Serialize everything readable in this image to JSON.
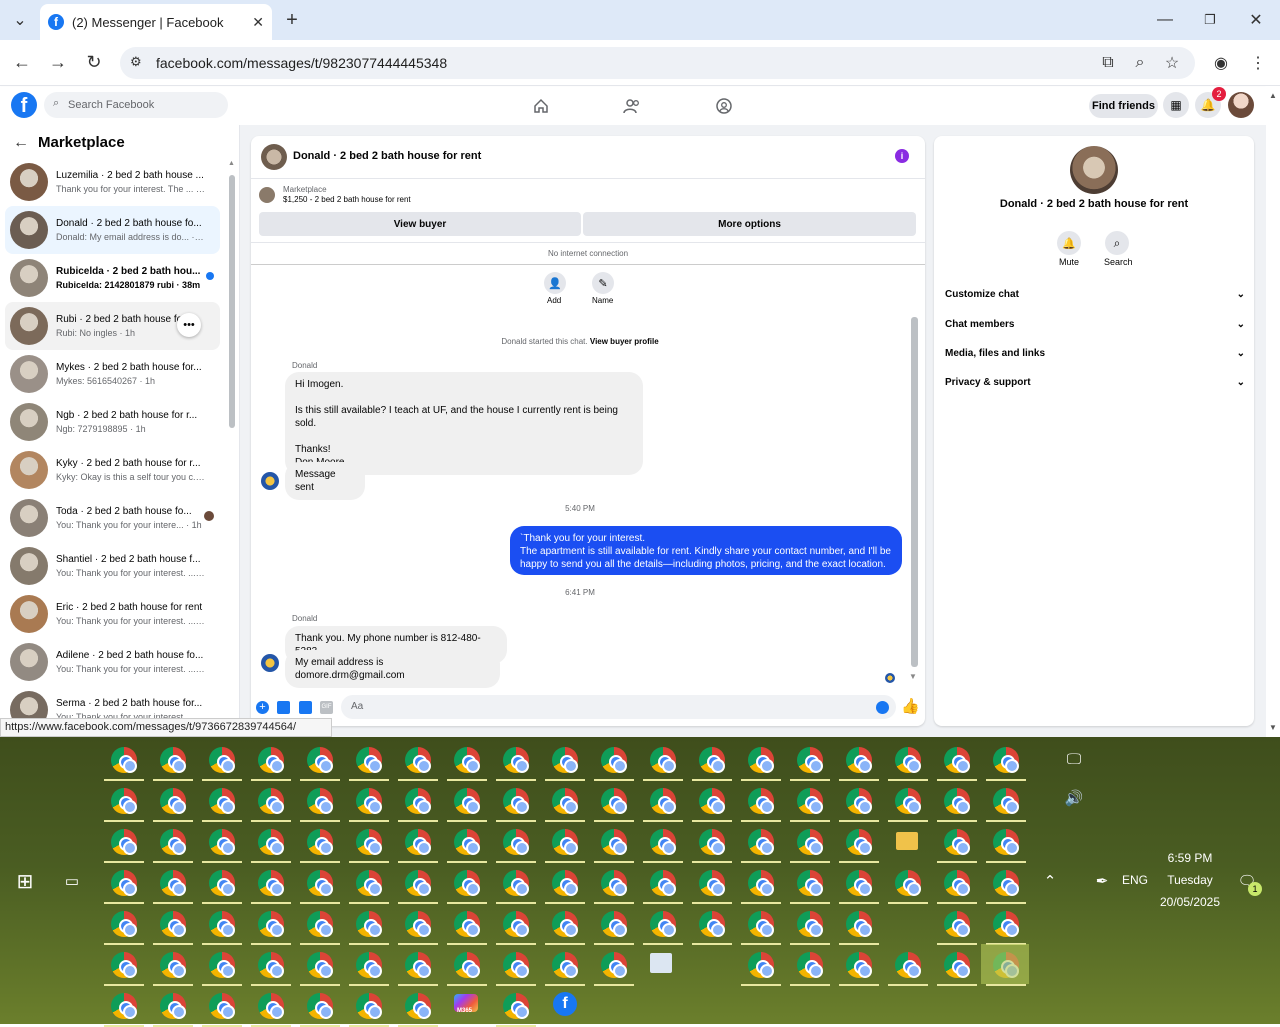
{
  "browser": {
    "tab_title": "(2) Messenger | Facebook",
    "url": "facebook.com/messages/t/9823077444445348",
    "status_url": "https://www.facebook.com/messages/t/9736672839744564/"
  },
  "fb": {
    "search_placeholder": "Search Facebook",
    "find_friends": "Find friends",
    "notif_count": "2"
  },
  "sidebar": {
    "title": "Marketplace",
    "conversations": [
      {
        "name": "Luzemilia · 2 bed 2 bath house ...",
        "preview": "Thank you for your interest. The ... · 1m"
      },
      {
        "name": "Donald · 2 bed 2 bath house fo...",
        "preview": "Donald: My email address is do... · 17m"
      },
      {
        "name": "Rubicelda · 2 bed 2 bath hou...",
        "preview": "Rubicelda: 2142801879 rubi · 38m"
      },
      {
        "name": "Rubi · 2 bed 2 bath house fo...",
        "preview": "Rubi: No ingles · 1h"
      },
      {
        "name": "Mykes · 2 bed 2 bath house for...",
        "preview": "Mykes: 5616540267 · 1h"
      },
      {
        "name": "Ngb · 2 bed 2 bath house for r...",
        "preview": "Ngb: 7279198895 · 1h"
      },
      {
        "name": "Kyky · 2 bed 2 bath house for r...",
        "preview": "Kyky: Okay is this a self tour you c... · 1h"
      },
      {
        "name": "Toda · 2 bed 2 bath house fo...",
        "preview": "You: Thank you for your intere... · 1h"
      },
      {
        "name": "Shantiel · 2 bed 2 bath house f...",
        "preview": "You: Thank you for your interest. ... · 1h"
      },
      {
        "name": "Eric · 2 bed 2 bath house for rent",
        "preview": "You: Thank you for your interest. ... · 1h"
      },
      {
        "name": "Adilene · 2 bed 2 bath house fo...",
        "preview": "You: Thank you for your interest. ... · 1h"
      },
      {
        "name": "Serma · 2 bed 2 bath house for...",
        "preview": "You: Thank you for your interest. ... · 1h"
      }
    ]
  },
  "chat": {
    "title": "Donald · 2 bed 2 bath house for rent",
    "listing_source": "Marketplace",
    "listing": "$1,250 - 2 bed 2 bath house for rent",
    "view_buyer": "View buyer",
    "more_options": "More options",
    "connection": "No internet connection",
    "add_label": "Add",
    "name_label": "Name",
    "started_text": "Donald started this chat.",
    "view_profile": "View buyer profile",
    "sender_name": "Donald",
    "msg1": "Hi Imogen.\n\nIs this still available? I teach at UF, and the house I currently rent is being sold.\n\nThanks!\nDon Moore",
    "msg2": "Message sent",
    "time1": "5:40 PM",
    "msg3": "`Thank you for your interest.\nThe apartment is still available for rent. Kindly share your contact number, and I'll be happy to send you all the details—including photos, pricing, and the exact location.",
    "time2": "6:41 PM",
    "msg4": "Thank you. My phone number is 812-480-5283",
    "msg5": "My email address is domore.drm@gmail.com",
    "input_placeholder": "Aa"
  },
  "info": {
    "title": "Donald · 2 bed 2 bath house for rent",
    "mute": "Mute",
    "search": "Search",
    "sections": [
      "Customize chat",
      "Chat members",
      "Media, files and links",
      "Privacy & support"
    ]
  },
  "taskbar": {
    "lang": "ENG",
    "time": "6:59 PM",
    "day": "Tuesday",
    "date": "20/05/2025",
    "notif_count": "1",
    "m365_label": "M365"
  },
  "colors": {
    "fb_blue": "#1877f2",
    "sent_bubble": "#1b4ef2",
    "desktop": "#4a5d22"
  }
}
